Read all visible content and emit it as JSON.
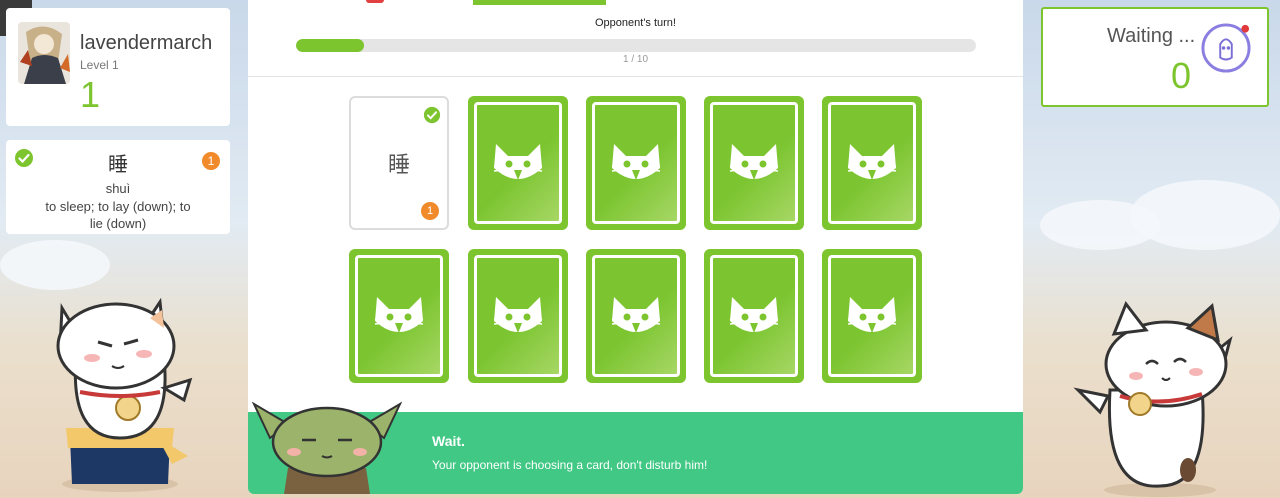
{
  "player": {
    "name": "lavendermarch",
    "level": "Level 1",
    "score": "1"
  },
  "word_card": {
    "character": "睡",
    "pinyin": "shuì",
    "definition": "to sleep; to lay (down); to lie (down)",
    "count": "1"
  },
  "game": {
    "status": "Opponent's turn!",
    "progress_text": "1 / 10",
    "progress": 0.1,
    "cards": [
      {
        "state": "revealed",
        "character": "睡",
        "count": "1"
      },
      {
        "state": "hidden"
      },
      {
        "state": "hidden"
      },
      {
        "state": "hidden"
      },
      {
        "state": "hidden"
      },
      {
        "state": "hidden"
      },
      {
        "state": "hidden"
      },
      {
        "state": "hidden"
      },
      {
        "state": "hidden"
      },
      {
        "state": "hidden"
      }
    ]
  },
  "banner": {
    "title": "Wait.",
    "message": "Your opponent is choosing a card, don't disturb him!"
  },
  "opponent": {
    "status": "Waiting ...",
    "score": "0"
  },
  "colors": {
    "accent": "#7dc52e",
    "banner": "#41c885",
    "badge": "#f08a2a"
  },
  "icons": {
    "chat": "chat-icon",
    "check": "check-circle-icon",
    "card_back": "cat-face-icon"
  }
}
